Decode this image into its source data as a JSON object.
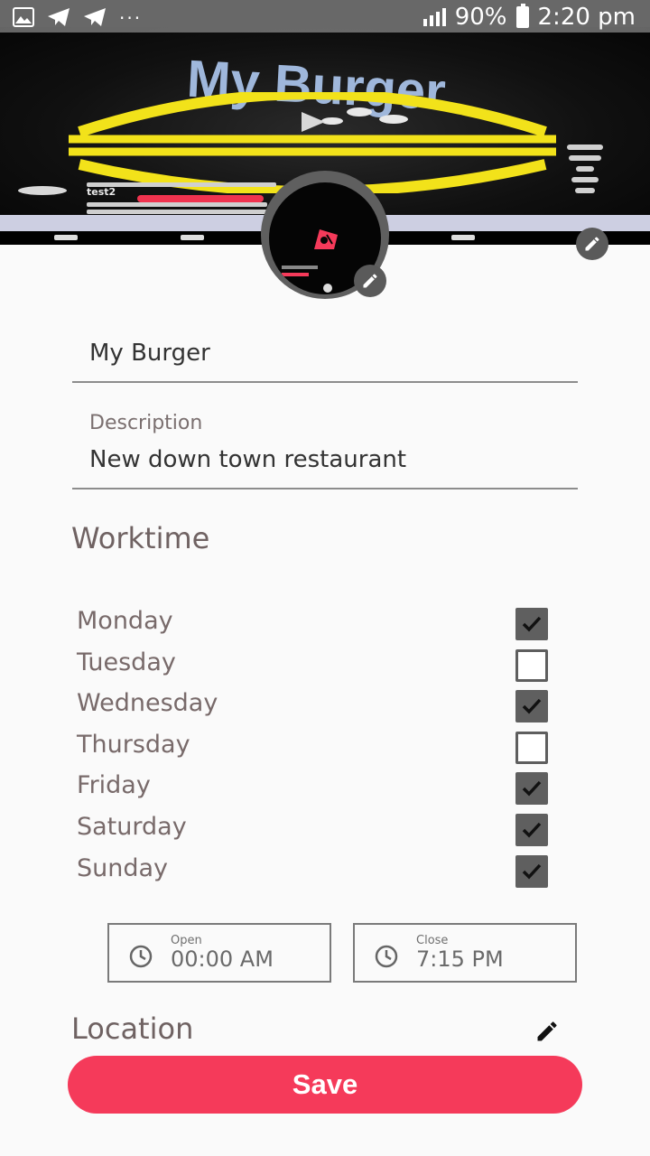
{
  "status_bar": {
    "battery": "90%",
    "time": "2:20 pm",
    "overflow": "···"
  },
  "cover": {
    "logo_text": "My Burger",
    "post_user": "test2"
  },
  "form": {
    "name_value": "My Burger",
    "description_label": "Description",
    "description_value": "New down town restaurant"
  },
  "worktime": {
    "title": "Worktime",
    "days": [
      {
        "label": "Monday",
        "checked": true
      },
      {
        "label": "Tuesday",
        "checked": false
      },
      {
        "label": "Wednesday",
        "checked": true
      },
      {
        "label": "Thursday",
        "checked": false
      },
      {
        "label": "Friday",
        "checked": true
      },
      {
        "label": "Saturday",
        "checked": true
      },
      {
        "label": "Sunday",
        "checked": true
      }
    ],
    "open_label": "Open",
    "open_value": "00:00 AM",
    "close_label": "Close",
    "close_value": "7:15 PM"
  },
  "location": {
    "title": "Location"
  },
  "save_label": "Save",
  "colors": {
    "accent": "#f53a5a",
    "burger_yellow": "#f2e21a",
    "checkbox_fill": "#5f5f5f",
    "text_muted": "#786a6a"
  },
  "icons": [
    "image-icon",
    "telegram-icon",
    "signal-icon",
    "battery-icon",
    "pencil-icon",
    "clock-icon",
    "checkmark-icon",
    "play-icon"
  ]
}
